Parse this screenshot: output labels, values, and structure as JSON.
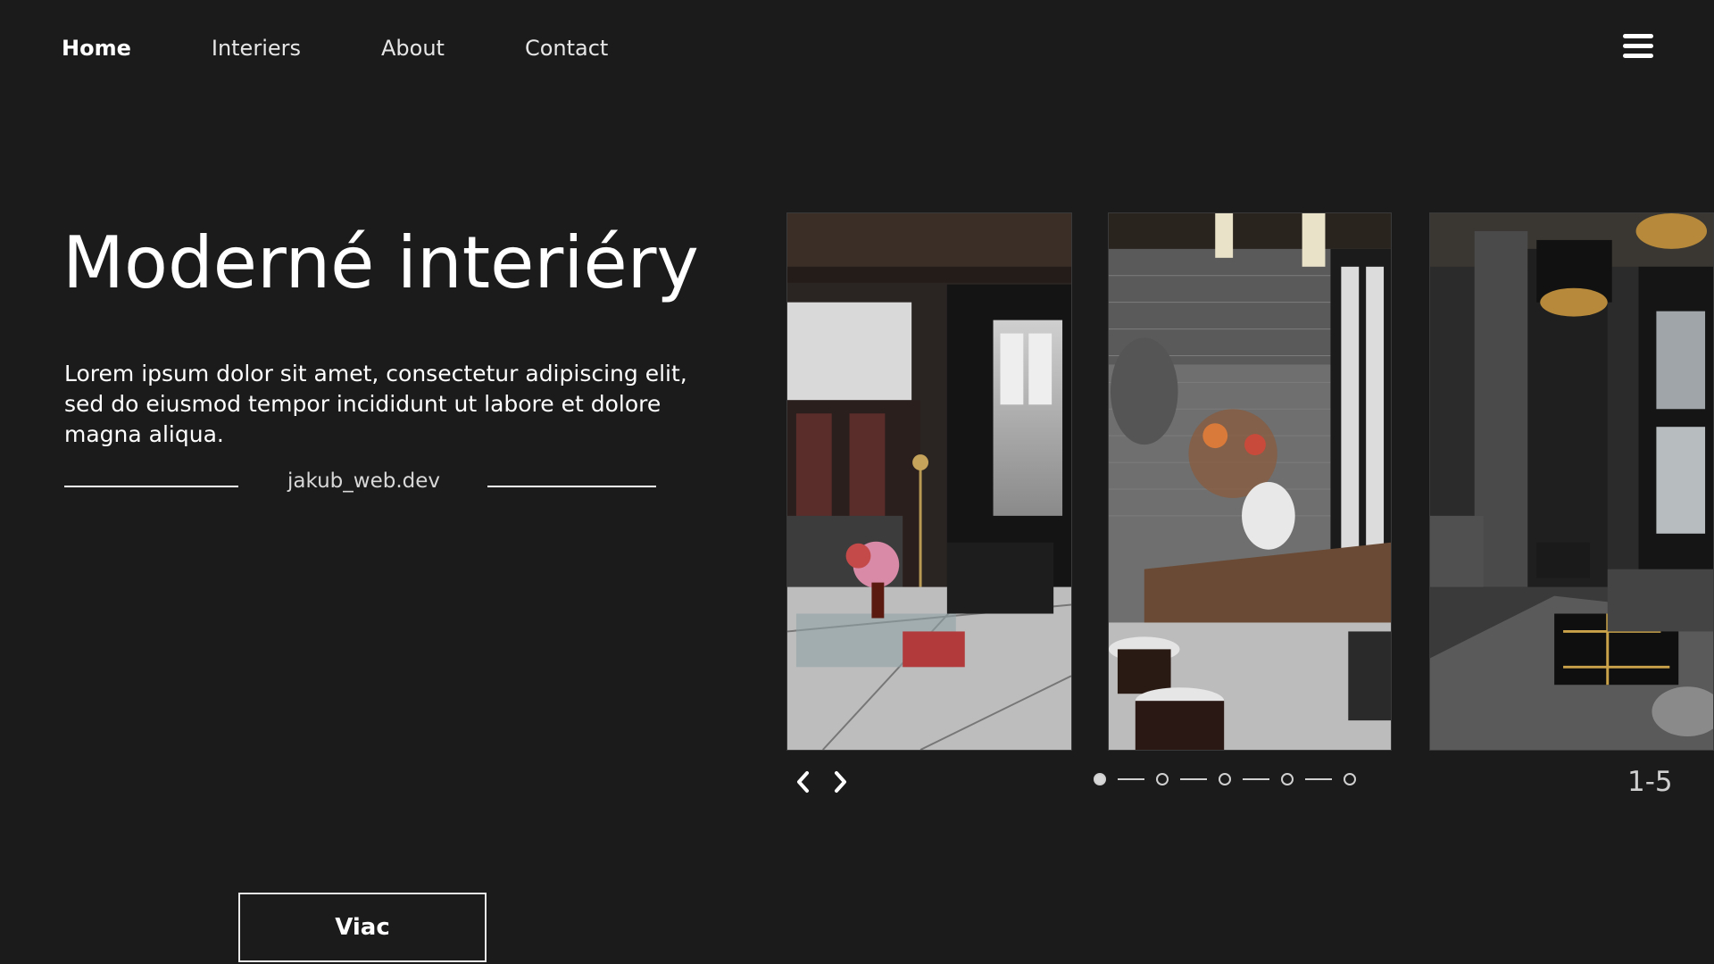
{
  "nav": {
    "items": [
      {
        "label": "Home",
        "active": true
      },
      {
        "label": "Interiers"
      },
      {
        "label": "About"
      },
      {
        "label": "Contact"
      }
    ],
    "menu_icon": "hamburger-menu-icon"
  },
  "hero": {
    "title": "Moderné interiéry",
    "description": "Lorem ipsum dolor sit amet, consectetur adipiscing elit, sed do eiusmod tempor incididunt ut labore et dolore magna aliqua.",
    "signature": "jakub_web.dev",
    "cta_label": "Viac"
  },
  "slider": {
    "counter": "1-5",
    "slides": [
      "slide-interior-1",
      "slide-interior-2",
      "slide-interior-3"
    ],
    "total_dots": 5,
    "active_dot": 0,
    "prev_icon": "chevron-left-icon",
    "next_icon": "chevron-right-icon"
  },
  "colors": {
    "background": "#1b1b1c",
    "text": "#ffffff",
    "muted": "#d0d0d0"
  }
}
